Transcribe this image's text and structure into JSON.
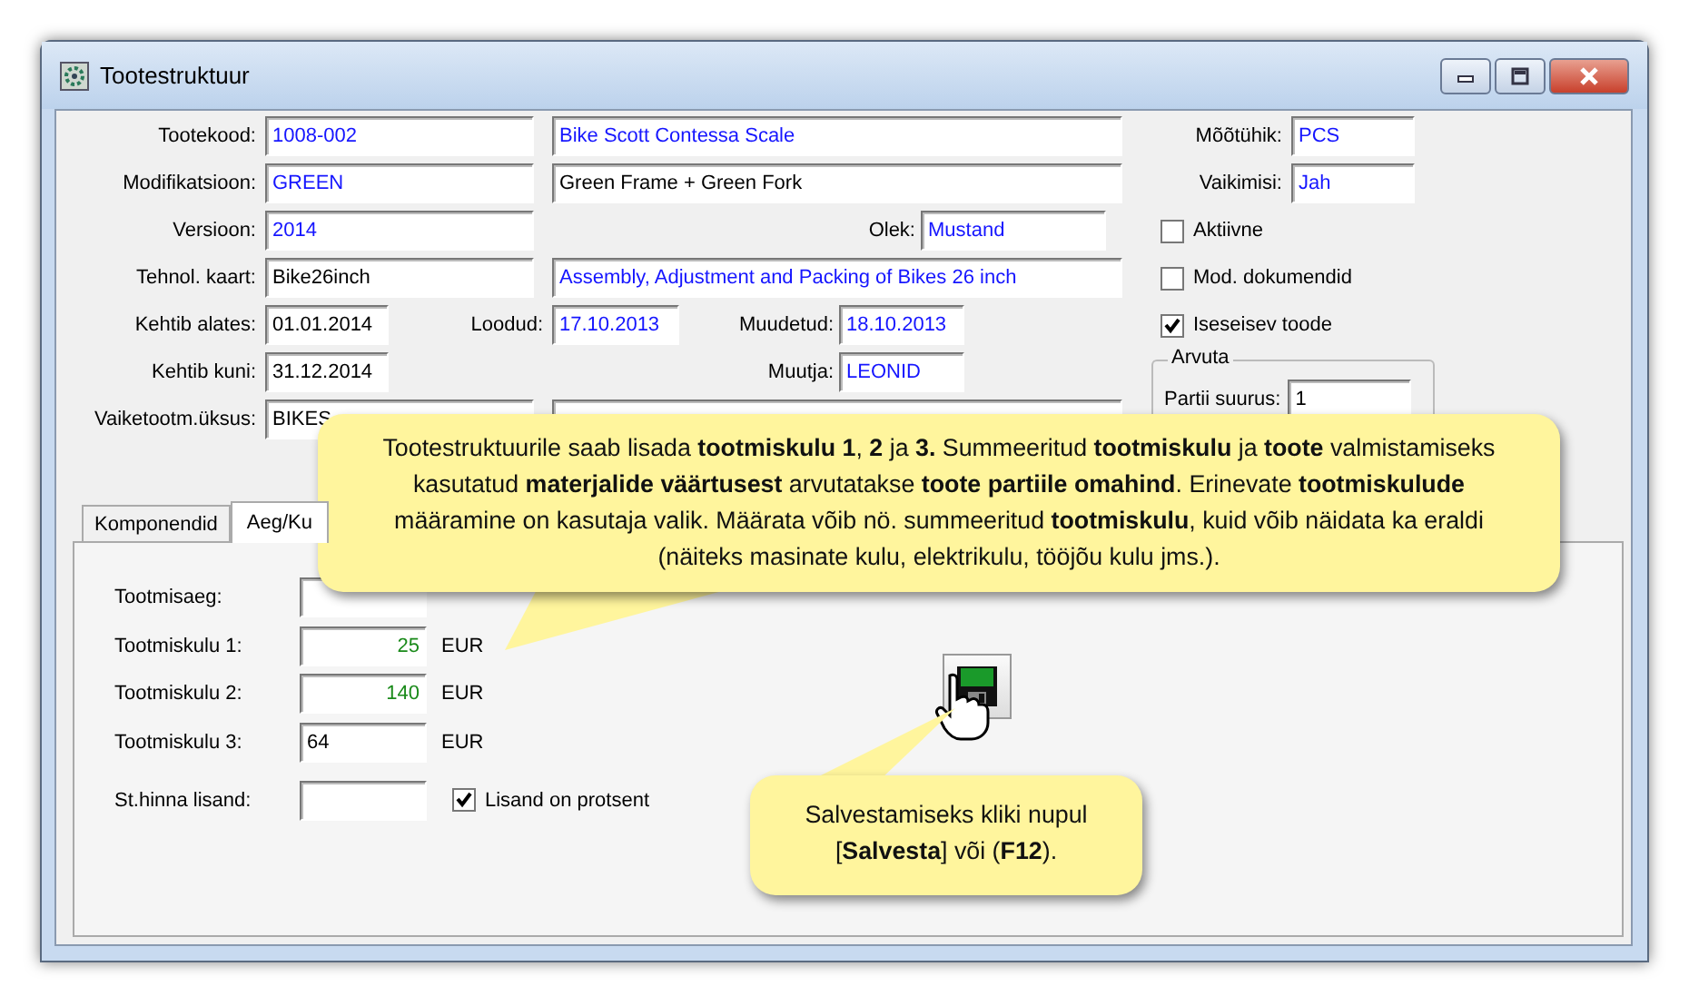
{
  "window": {
    "title": "Tootestruktuur"
  },
  "product": {
    "code": {
      "label": "Tootekood:",
      "value": "1008-002",
      "linked": true
    },
    "name": {
      "value": "Bike Scott Contessa Scale",
      "linked": true
    },
    "modification": {
      "label": "Modifikatsioon:",
      "value": "GREEN",
      "linked": true
    },
    "modification_name": {
      "value": "Green Frame + Green Fork",
      "linked": false
    },
    "version": {
      "label": "Versioon:",
      "value": "2014",
      "linked": true
    },
    "status": {
      "label": "Olek:",
      "value": "Mustand",
      "linked": true
    },
    "route": {
      "label": "Tehnol. kaart:",
      "value": "Bike26inch",
      "linked": false
    },
    "route_name": {
      "value": "Assembly, Adjustment and Packing of Bikes 26 inch",
      "linked": true
    },
    "valid_from": {
      "label": "Kehtib alates:",
      "value": "01.01.2014",
      "linked": false
    },
    "created": {
      "label": "Loodud:",
      "value": "17.10.2013",
      "linked": true
    },
    "modified": {
      "label": "Muudetud:",
      "value": "18.10.2013",
      "linked": true
    },
    "valid_to": {
      "label": "Kehtib kuni:",
      "value": "31.12.2014",
      "linked": false
    },
    "modifier": {
      "label": "Muutja:",
      "value": "LEONID",
      "linked": true
    },
    "unit_group": {
      "label": "Vaiketootm.üksus:",
      "value": "BIKES",
      "linked": false
    }
  },
  "side": {
    "unit": {
      "label": "Mõõtühik:",
      "value": "PCS",
      "linked": true
    },
    "default": {
      "label": "Vaikimisi:",
      "value": "Jah",
      "linked": true
    },
    "checkboxes": [
      {
        "label": "Aktiivne",
        "checked": false
      },
      {
        "label": "Mod. dokumendid",
        "checked": false
      },
      {
        "label": "Iseseisev toode",
        "checked": true
      }
    ],
    "calc_group": {
      "title": "Arvuta",
      "label": "Partii suurus:",
      "value": "1"
    }
  },
  "tabs": [
    {
      "label": "Komponendid",
      "selected": false
    },
    {
      "label": "Aeg/Ku",
      "selected": true
    }
  ],
  "panel": {
    "time": {
      "label": "Tootmisaeg:"
    },
    "costs": [
      {
        "label": "Tootmiskulu 1:",
        "value": "25",
        "kind": "stored",
        "unit": "EUR"
      },
      {
        "label": "Tootmiskulu 2:",
        "value": "140",
        "kind": "stored",
        "unit": "EUR"
      },
      {
        "label": "Tootmiskulu 3:",
        "value": "64",
        "kind": "editing",
        "unit": "EUR"
      }
    ],
    "markup": {
      "label": "St.hinna lisand:"
    },
    "percent": {
      "label": "Lisand on protsent",
      "checked": true
    }
  },
  "callouts": [
    {
      "text": "Tootestruktuurile saab lisada **tootmiskulu 1**, **2** ja **3.** Summeeritud **tootmiskulu** ja **toote** valmistamiseks kasutatud **materjalide väärtusest** arvutatakse **toote partiile omahind**. Erinevate **tootmiskulude** määramine on kasutaja valik. Määrata võib nö. summeeritud **tootmiskulu**, kuid võib näidata ka eraldi (näiteks masinate kulu, elektrikulu, tööjõu kulu jms.)."
    },
    {
      "text": "Salvestamiseks kliki nupul [**Salvesta**] või (**F12**)."
    }
  ]
}
